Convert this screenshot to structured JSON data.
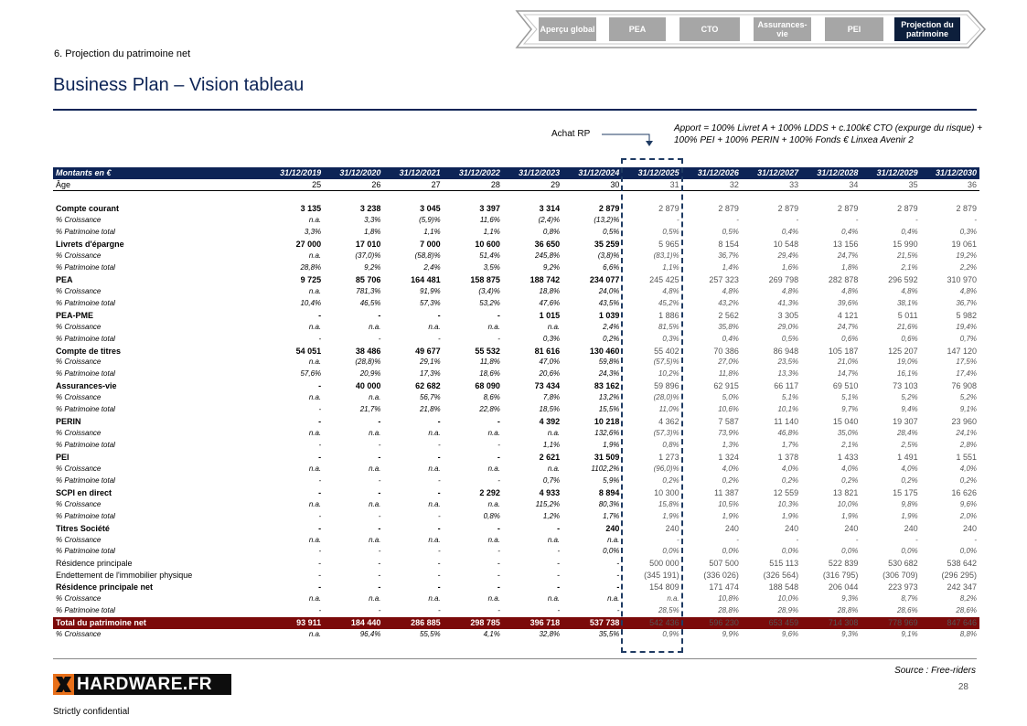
{
  "nav": {
    "tabs": [
      {
        "label": "Aperçu global",
        "active": false
      },
      {
        "label": "PEA",
        "active": false
      },
      {
        "label": "CTO",
        "active": false
      },
      {
        "label": "Assurances-vie",
        "active": false
      },
      {
        "label": "PEI",
        "active": false
      },
      {
        "label": "Projection du patrimoine",
        "active": true
      }
    ]
  },
  "section_label": "6. Projection du patrimoine net",
  "title": "Business Plan – Vision tableau",
  "achat_label": "Achat RP",
  "apport_note": "Apport = 100% Livret A + 100% LDDS + c.100k€ CTO (expurge du risque) + 100% PEI + 100% PERIN + 100% Fonds € Linxea Avenir 2",
  "table": {
    "header_label": "Montants en €",
    "years": [
      "31/12/2019",
      "31/12/2020",
      "31/12/2021",
      "31/12/2022",
      "31/12/2023",
      "31/12/2024",
      "31/12/2025",
      "31/12/2026",
      "31/12/2027",
      "31/12/2028",
      "31/12/2029",
      "31/12/2030"
    ],
    "rows": [
      {
        "type": "age",
        "label": "Âge",
        "values": [
          "25",
          "26",
          "27",
          "28",
          "29",
          "30",
          "31",
          "32",
          "33",
          "34",
          "35",
          "36"
        ]
      },
      {
        "type": "spacer",
        "label": "",
        "values": [
          "",
          "",
          "",
          "",
          "",
          "",
          "",
          "",
          "",
          "",
          "",
          ""
        ]
      },
      {
        "type": "main",
        "label": "Compte courant",
        "values": [
          "3 135",
          "3 238",
          "3 045",
          "3 397",
          "3 314",
          "2 879",
          "2 879",
          "2 879",
          "2 879",
          "2 879",
          "2 879",
          "2 879"
        ]
      },
      {
        "type": "sub",
        "label": "% Croissance",
        "values": [
          "n.a.",
          "3,3%",
          "(5,9)%",
          "11,6%",
          "(2,4)%",
          "(13,2)%",
          "-",
          "-",
          "-",
          "-",
          "-",
          "-"
        ]
      },
      {
        "type": "sub",
        "label": "% Patrimoine total",
        "values": [
          "3,3%",
          "1,8%",
          "1,1%",
          "1,1%",
          "0,8%",
          "0,5%",
          "0,5%",
          "0,5%",
          "0,4%",
          "0,4%",
          "0,4%",
          "0,3%"
        ]
      },
      {
        "type": "main",
        "label": "Livrets d'épargne",
        "values": [
          "27 000",
          "17 010",
          "7 000",
          "10 600",
          "36 650",
          "35 259",
          "5 965",
          "8 154",
          "10 548",
          "13 156",
          "15 990",
          "19 061"
        ]
      },
      {
        "type": "sub",
        "label": "% Croissance",
        "values": [
          "n.a.",
          "(37,0)%",
          "(58,8)%",
          "51,4%",
          "245,8%",
          "(3,8)%",
          "(83,1)%",
          "36,7%",
          "29,4%",
          "24,7%",
          "21,5%",
          "19,2%"
        ]
      },
      {
        "type": "sub",
        "label": "% Patrimoine total",
        "values": [
          "28,8%",
          "9,2%",
          "2,4%",
          "3,5%",
          "9,2%",
          "6,6%",
          "1,1%",
          "1,4%",
          "1,6%",
          "1,8%",
          "2,1%",
          "2,2%"
        ]
      },
      {
        "type": "main",
        "label": "PEA",
        "values": [
          "9 725",
          "85 706",
          "164 481",
          "158 875",
          "188 742",
          "234 077",
          "245 425",
          "257 323",
          "269 798",
          "282 878",
          "296 592",
          "310 970"
        ]
      },
      {
        "type": "sub",
        "label": "% Croissance",
        "values": [
          "n.a.",
          "781,3%",
          "91,9%",
          "(3,4)%",
          "18,8%",
          "24,0%",
          "4,8%",
          "4,8%",
          "4,8%",
          "4,8%",
          "4,8%",
          "4,8%"
        ]
      },
      {
        "type": "sub",
        "label": "% Patrimoine total",
        "values": [
          "10,4%",
          "46,5%",
          "57,3%",
          "53,2%",
          "47,6%",
          "43,5%",
          "45,2%",
          "43,2%",
          "41,3%",
          "39,6%",
          "38,1%",
          "36,7%"
        ]
      },
      {
        "type": "main",
        "label": "PEA-PME",
        "values": [
          "-",
          "-",
          "-",
          "-",
          "1 015",
          "1 039",
          "1 886",
          "2 562",
          "3 305",
          "4 121",
          "5 011",
          "5 982"
        ]
      },
      {
        "type": "sub",
        "label": "% Croissance",
        "values": [
          "n.a.",
          "n.a.",
          "n.a.",
          "n.a.",
          "n.a.",
          "2,4%",
          "81,5%",
          "35,8%",
          "29,0%",
          "24,7%",
          "21,6%",
          "19,4%"
        ]
      },
      {
        "type": "sub",
        "label": "% Patrimoine total",
        "values": [
          "-",
          "-",
          "-",
          "-",
          "0,3%",
          "0,2%",
          "0,3%",
          "0,4%",
          "0,5%",
          "0,6%",
          "0,6%",
          "0,7%"
        ]
      },
      {
        "type": "main",
        "label": "Compte de titres",
        "values": [
          "54 051",
          "38 486",
          "49 677",
          "55 532",
          "81 616",
          "130 460",
          "55 402",
          "70 386",
          "86 948",
          "105 187",
          "125 207",
          "147 120"
        ]
      },
      {
        "type": "sub",
        "label": "% Croissance",
        "values": [
          "n.a.",
          "(28,8)%",
          "29,1%",
          "11,8%",
          "47,0%",
          "59,8%",
          "(57,5)%",
          "27,0%",
          "23,5%",
          "21,0%",
          "19,0%",
          "17,5%"
        ]
      },
      {
        "type": "sub",
        "label": "% Patrimoine total",
        "values": [
          "57,6%",
          "20,9%",
          "17,3%",
          "18,6%",
          "20,6%",
          "24,3%",
          "10,2%",
          "11,8%",
          "13,3%",
          "14,7%",
          "16,1%",
          "17,4%"
        ]
      },
      {
        "type": "main",
        "label": "Assurances-vie",
        "values": [
          "-",
          "40 000",
          "62 682",
          "68 090",
          "73 434",
          "83 162",
          "59 896",
          "62 915",
          "66 117",
          "69 510",
          "73 103",
          "76 908"
        ]
      },
      {
        "type": "sub",
        "label": "% Croissance",
        "values": [
          "n.a.",
          "n.a.",
          "56,7%",
          "8,6%",
          "7,8%",
          "13,2%",
          "(28,0)%",
          "5,0%",
          "5,1%",
          "5,1%",
          "5,2%",
          "5,2%"
        ]
      },
      {
        "type": "sub",
        "label": "% Patrimoine total",
        "values": [
          "-",
          "21,7%",
          "21,8%",
          "22,8%",
          "18,5%",
          "15,5%",
          "11,0%",
          "10,6%",
          "10,1%",
          "9,7%",
          "9,4%",
          "9,1%"
        ]
      },
      {
        "type": "main",
        "label": "PERIN",
        "values": [
          "-",
          "-",
          "-",
          "-",
          "4 392",
          "10 218",
          "4 362",
          "7 587",
          "11 140",
          "15 040",
          "19 307",
          "23 960"
        ]
      },
      {
        "type": "sub",
        "label": "% Croissance",
        "values": [
          "n.a.",
          "n.a.",
          "n.a.",
          "n.a.",
          "n.a.",
          "132,6%",
          "(57,3)%",
          "73,9%",
          "46,8%",
          "35,0%",
          "28,4%",
          "24,1%"
        ]
      },
      {
        "type": "sub",
        "label": "% Patrimoine total",
        "values": [
          "-",
          "-",
          "-",
          "-",
          "1,1%",
          "1,9%",
          "0,8%",
          "1,3%",
          "1,7%",
          "2,1%",
          "2,5%",
          "2,8%"
        ]
      },
      {
        "type": "main",
        "label": "PEI",
        "values": [
          "-",
          "-",
          "-",
          "-",
          "2 621",
          "31 509",
          "1 273",
          "1 324",
          "1 378",
          "1 433",
          "1 491",
          "1 551"
        ]
      },
      {
        "type": "sub",
        "label": "% Croissance",
        "values": [
          "n.a.",
          "n.a.",
          "n.a.",
          "n.a.",
          "n.a.",
          "1102,2%",
          "(96,0)%",
          "4,0%",
          "4,0%",
          "4,0%",
          "4,0%",
          "4,0%"
        ]
      },
      {
        "type": "sub",
        "label": "% Patrimoine total",
        "values": [
          "-",
          "-",
          "-",
          "-",
          "0,7%",
          "5,9%",
          "0,2%",
          "0,2%",
          "0,2%",
          "0,2%",
          "0,2%",
          "0,2%"
        ]
      },
      {
        "type": "main",
        "label": "SCPI en direct",
        "values": [
          "-",
          "-",
          "-",
          "2 292",
          "4 933",
          "8 894",
          "10 300",
          "11 387",
          "12 559",
          "13 821",
          "15 175",
          "16 626"
        ]
      },
      {
        "type": "sub",
        "label": "% Croissance",
        "values": [
          "n.a.",
          "n.a.",
          "n.a.",
          "n.a.",
          "115,2%",
          "80,3%",
          "15,8%",
          "10,5%",
          "10,3%",
          "10,0%",
          "9,8%",
          "9,6%"
        ]
      },
      {
        "type": "sub",
        "label": "% Patrimoine total",
        "values": [
          "-",
          "-",
          "-",
          "0,8%",
          "1,2%",
          "1,7%",
          "1,9%",
          "1,9%",
          "1,9%",
          "1,9%",
          "1,9%",
          "2,0%"
        ]
      },
      {
        "type": "main",
        "label": "Titres Société",
        "values": [
          "-",
          "-",
          "-",
          "-",
          "-",
          "240",
          "240",
          "240",
          "240",
          "240",
          "240",
          "240"
        ]
      },
      {
        "type": "sub",
        "label": "% Croissance",
        "values": [
          "n.a.",
          "n.a.",
          "n.a.",
          "n.a.",
          "n.a.",
          "n.a.",
          "-",
          "-",
          "-",
          "-",
          "-",
          "-"
        ]
      },
      {
        "type": "sub",
        "label": "% Patrimoine total",
        "values": [
          "-",
          "-",
          "-",
          "-",
          "-",
          "0,0%",
          "0,0%",
          "0,0%",
          "0,0%",
          "0,0%",
          "0,0%",
          "0,0%"
        ]
      },
      {
        "type": "plain",
        "label": "Résidence principale",
        "values": [
          "-",
          "-",
          "-",
          "-",
          "-",
          "-",
          "500 000",
          "507 500",
          "515 113",
          "522 839",
          "530 682",
          "538 642"
        ]
      },
      {
        "type": "plain",
        "label": "Endettement de l'immobilier physique",
        "values": [
          "-",
          "-",
          "-",
          "-",
          "-",
          "-",
          "(345 191)",
          "(336 026)",
          "(326 564)",
          "(316 795)",
          "(306 709)",
          "(296 295)"
        ]
      },
      {
        "type": "main",
        "label": "Résidence principale net",
        "values": [
          "-",
          "-",
          "-",
          "-",
          "-",
          "-",
          "154 809",
          "171 474",
          "188 548",
          "206 044",
          "223 973",
          "242 347"
        ]
      },
      {
        "type": "sub",
        "label": "% Croissance",
        "values": [
          "n.a.",
          "n.a.",
          "n.a.",
          "n.a.",
          "n.a.",
          "n.a.",
          "n.a.",
          "10,8%",
          "10,0%",
          "9,3%",
          "8,7%",
          "8,2%"
        ]
      },
      {
        "type": "sub",
        "label": "% Patrimoine total",
        "values": [
          "-",
          "-",
          "-",
          "-",
          "-",
          "-",
          "28,5%",
          "28,8%",
          "28,9%",
          "28,8%",
          "28,6%",
          "28,6%"
        ]
      },
      {
        "type": "total",
        "label": "Total du patrimoine net",
        "values": [
          "93 911",
          "184 440",
          "286 885",
          "298 785",
          "396 718",
          "537 738",
          "542 436",
          "596 230",
          "653 459",
          "714 308",
          "778 969",
          "847 646"
        ]
      },
      {
        "type": "sub",
        "label": "% Croissance",
        "values": [
          "n.a.",
          "96,4%",
          "55,5%",
          "4,1%",
          "32,8%",
          "35,5%",
          "0,9%",
          "9,9%",
          "9,6%",
          "9,3%",
          "9,1%",
          "8,8%"
        ]
      }
    ]
  },
  "logo_text": "HARDWARE.FR",
  "source": "Source : Free-riders",
  "page_number": "28",
  "footer_text": "Strictly confidential",
  "colors": {
    "navy": "#0d2456",
    "total_row": "#7b0a0a",
    "logo_orange": "#e8701a"
  }
}
